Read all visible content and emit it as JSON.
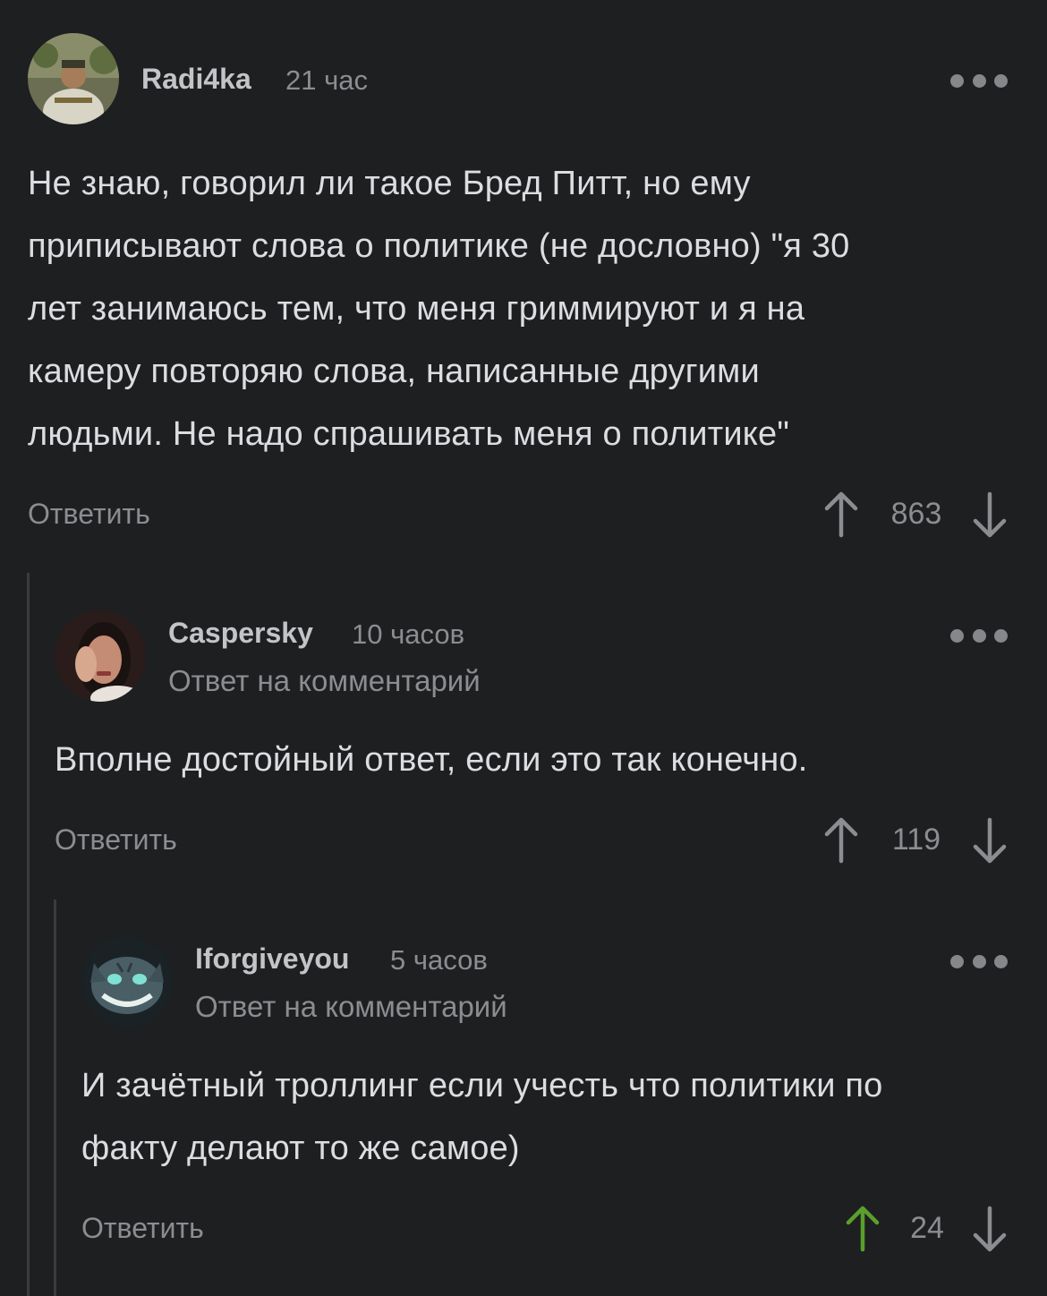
{
  "colors": {
    "background": "#1e1f21",
    "text": "#dcdde0",
    "muted": "#8b8d91",
    "upvote_active": "#5aa02c"
  },
  "comments": [
    {
      "username": "Radi4ka",
      "time": "21 час",
      "reply_note": "",
      "text_lines": [
        "Не знаю, говорил ли такое Бред Питт, но ему",
        "приписывают слова о политике (не дословно) \"я 30",
        "лет занимаюсь тем, что меня гриммируют и я на",
        "камеру повторяю слова, написанные другими",
        "людьми. Не надо спрашивать меня о политике\""
      ],
      "reply_label": "Ответить",
      "score": "863",
      "upvoted": false,
      "avatar_icon": "user-avatar-man-in-uniform"
    },
    {
      "username": "Caspersky",
      "time": "10 часов",
      "reply_note": "Ответ на комментарий",
      "text_lines": [
        "Вполне достойный ответ, если это так конечно."
      ],
      "reply_label": "Ответить",
      "score": "119",
      "upvoted": false,
      "avatar_icon": "user-avatar-woman"
    },
    {
      "username": "Iforgiveyou",
      "time": "5 часов",
      "reply_note": "Ответ на комментарий",
      "text_lines": [
        "И зачётный троллинг если учесть что политики по",
        "факту делают то же самое)"
      ],
      "reply_label": "Ответить",
      "score": "24",
      "upvoted": true,
      "avatar_icon": "user-avatar-cheshire-cat"
    }
  ]
}
